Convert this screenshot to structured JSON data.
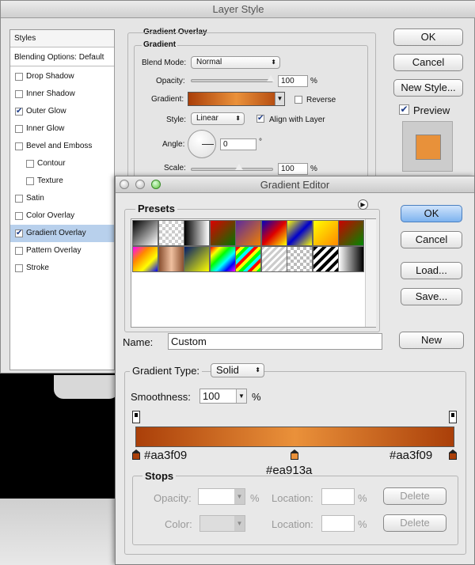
{
  "layer_style": {
    "title": "Layer Style",
    "styles_header": "Styles",
    "blending": "Blending Options: Default",
    "items": [
      {
        "label": "Drop Shadow",
        "checked": false,
        "indent": false,
        "selected": false
      },
      {
        "label": "Inner Shadow",
        "checked": false,
        "indent": false,
        "selected": false
      },
      {
        "label": "Outer Glow",
        "checked": true,
        "indent": false,
        "selected": false
      },
      {
        "label": "Inner Glow",
        "checked": false,
        "indent": false,
        "selected": false
      },
      {
        "label": "Bevel and Emboss",
        "checked": false,
        "indent": false,
        "selected": false
      },
      {
        "label": "Contour",
        "checked": false,
        "indent": true,
        "selected": false
      },
      {
        "label": "Texture",
        "checked": false,
        "indent": true,
        "selected": false
      },
      {
        "label": "Satin",
        "checked": false,
        "indent": false,
        "selected": false
      },
      {
        "label": "Color Overlay",
        "checked": false,
        "indent": false,
        "selected": false
      },
      {
        "label": "Gradient Overlay",
        "checked": true,
        "indent": false,
        "selected": true
      },
      {
        "label": "Pattern Overlay",
        "checked": false,
        "indent": false,
        "selected": false
      },
      {
        "label": "Stroke",
        "checked": false,
        "indent": false,
        "selected": false
      }
    ],
    "section_title": "Gradient Overlay",
    "group_title": "Gradient",
    "blend_mode_label": "Blend Mode:",
    "blend_mode_value": "Normal",
    "opacity_label": "Opacity:",
    "opacity_value": "100",
    "percent": "%",
    "gradient_label": "Gradient:",
    "reverse_label": "Reverse",
    "style_label": "Style:",
    "style_value": "Linear",
    "align_label": "Align with Layer",
    "angle_label": "Angle:",
    "angle_value": "0",
    "degree": "°",
    "scale_label": "Scale:",
    "scale_value": "100",
    "ok": "OK",
    "cancel": "Cancel",
    "new_style": "New Style...",
    "preview_label": "Preview",
    "preview_color": "#e8913a"
  },
  "gradient_editor": {
    "title": "Gradient Editor",
    "presets_label": "Presets",
    "ok": "OK",
    "cancel": "Cancel",
    "load": "Load...",
    "save": "Save...",
    "name_label": "Name:",
    "name_value": "Custom",
    "new_button": "New",
    "gradient_type_label": "Gradient Type:",
    "gradient_type_value": "Solid",
    "smoothness_label": "Smoothness:",
    "smoothness_value": "100",
    "percent": "%",
    "color_left": "#aa3f09",
    "color_mid": "#ea913a",
    "color_right": "#aa3f09",
    "stops_label": "Stops",
    "opacity_label": "Opacity:",
    "location_label": "Location:",
    "color_label": "Color:",
    "delete": "Delete",
    "preset_gradients": [
      "linear-gradient(135deg,#000,#fff)",
      "repeating-conic-gradient(#ccc 0 25%,#fff 0 50%) 0 0/8px 8px",
      "linear-gradient(90deg,#000,#fff)",
      "linear-gradient(135deg,#d00,#070)",
      "linear-gradient(135deg,#5a2aa0,#f08000)",
      "linear-gradient(135deg,#0000c0,#d00,#ff0)",
      "linear-gradient(135deg,#ff0,#00c,#ff0)",
      "linear-gradient(135deg,#ff0,#f80)",
      "linear-gradient(135deg,#c00,#080)",
      "linear-gradient(135deg,#f0f,#f80,#ff0,#00f)",
      "linear-gradient(90deg,#8a5030,#f0c0a0,#8a5030)",
      "linear-gradient(135deg,#001a6a,#ff0)",
      "linear-gradient(135deg,#f00,#ff0,#0f0,#0ff,#00f,#f0f)",
      "repeating-linear-gradient(135deg,#f00 0 4px,#ff0 4px 8px,#0f0 8px 12px,#0ff 12px 16px)",
      "repeating-linear-gradient(135deg,#ccc 0 3px,#fff 3px 6px)",
      "repeating-conic-gradient(#bbb 0 25%,#fff 0 50%) 0 0/8px 8px",
      "repeating-linear-gradient(135deg,#000 0 4px,#fff 4px 8px)",
      "linear-gradient(90deg,#fff,#000)"
    ]
  }
}
